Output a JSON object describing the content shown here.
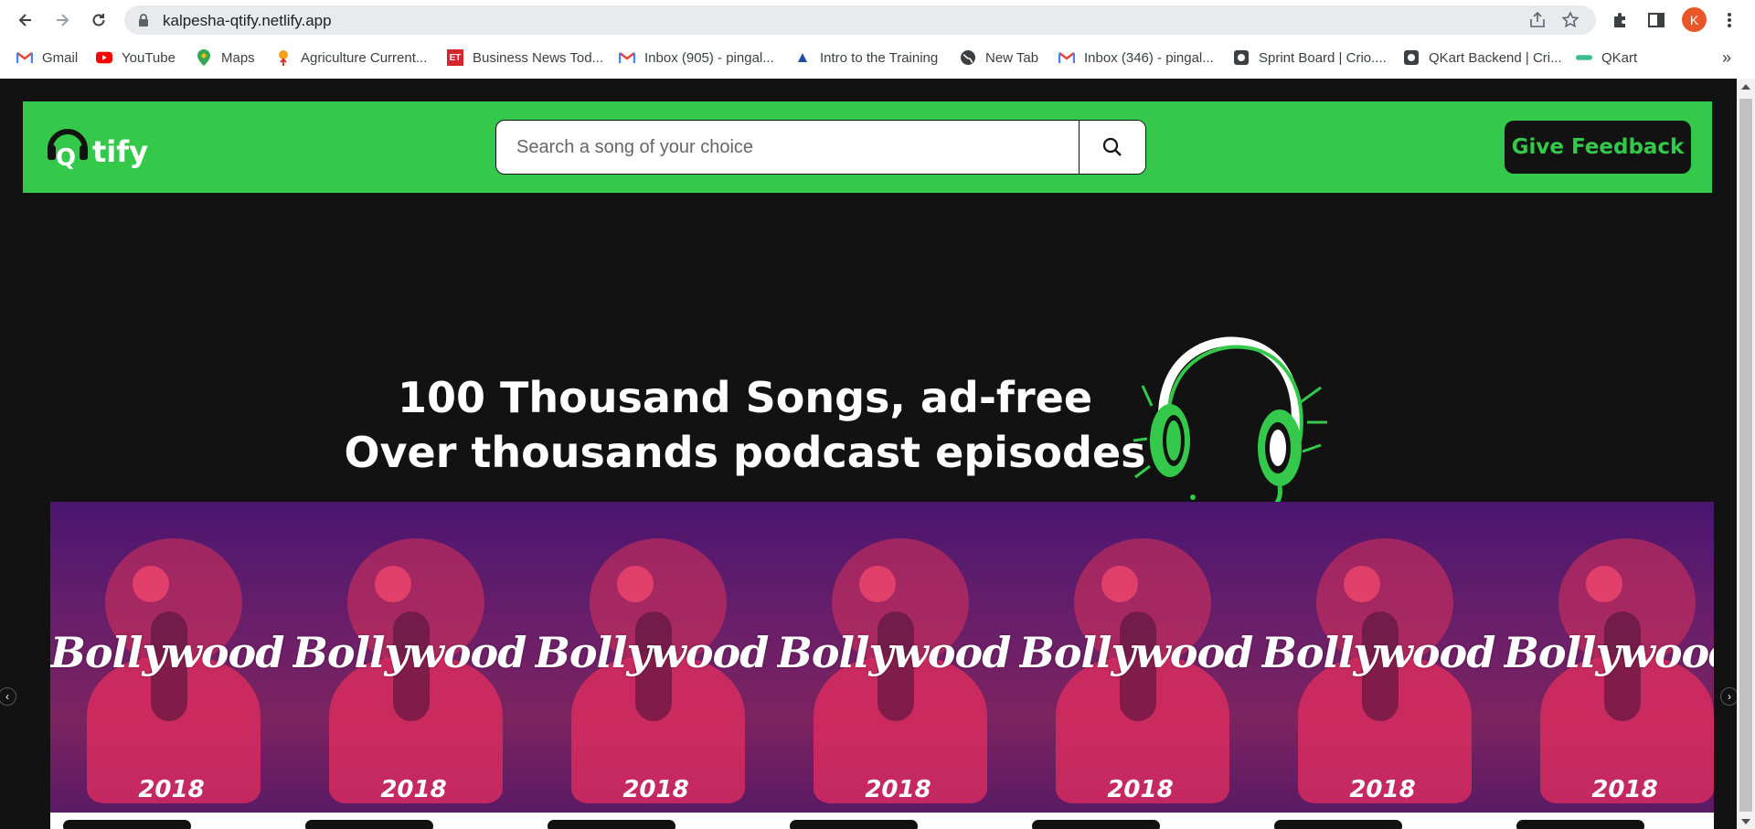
{
  "browser": {
    "url": "kalpesha-qtify.netlify.app",
    "profile_initial": "K",
    "bookmarks": [
      {
        "label": "Gmail",
        "icon": "gmail-icon"
      },
      {
        "label": "YouTube",
        "icon": "youtube-icon"
      },
      {
        "label": "Maps",
        "icon": "maps-icon"
      },
      {
        "label": "Agriculture Current...",
        "icon": "agriculture-icon"
      },
      {
        "label": "Business News Tod...",
        "icon": "et-icon"
      },
      {
        "label": "Inbox (905) - pingal...",
        "icon": "gmail-icon"
      },
      {
        "label": "Intro to the Training",
        "icon": "training-icon"
      },
      {
        "label": "New Tab",
        "icon": "globe-icon"
      },
      {
        "label": "Inbox (346) - pingal...",
        "icon": "gmail-icon"
      },
      {
        "label": "Sprint Board | Crio....",
        "icon": "crio-icon"
      },
      {
        "label": "QKart Backend | Cri...",
        "icon": "crio-icon"
      },
      {
        "label": "QKart",
        "icon": "qkart-icon"
      }
    ],
    "more_bookmarks": "»"
  },
  "navbar": {
    "logo_letter": "Q",
    "logo_text": "tify",
    "search_placeholder": "Search a song of your choice",
    "feedback_label": "Give Feedback"
  },
  "hero": {
    "line1": "100 Thousand Songs, ad-free",
    "line2": "Over thousands podcast episodes"
  },
  "carousel": {
    "cards": [
      {
        "title": "Bollywood Hi",
        "year": "2018"
      },
      {
        "title": "Bollywood Hi",
        "year": "2018"
      },
      {
        "title": "Bollywood Hi",
        "year": "2018"
      },
      {
        "title": "Bollywood Hi",
        "year": "2018"
      },
      {
        "title": "Bollywood Hi",
        "year": "2018"
      },
      {
        "title": "Bollywood Hi",
        "year": "2018"
      },
      {
        "title": "Bollywood Hi",
        "year": "2018"
      }
    ]
  },
  "colors": {
    "brand_green": "#34c94a",
    "page_background": "#121212"
  }
}
